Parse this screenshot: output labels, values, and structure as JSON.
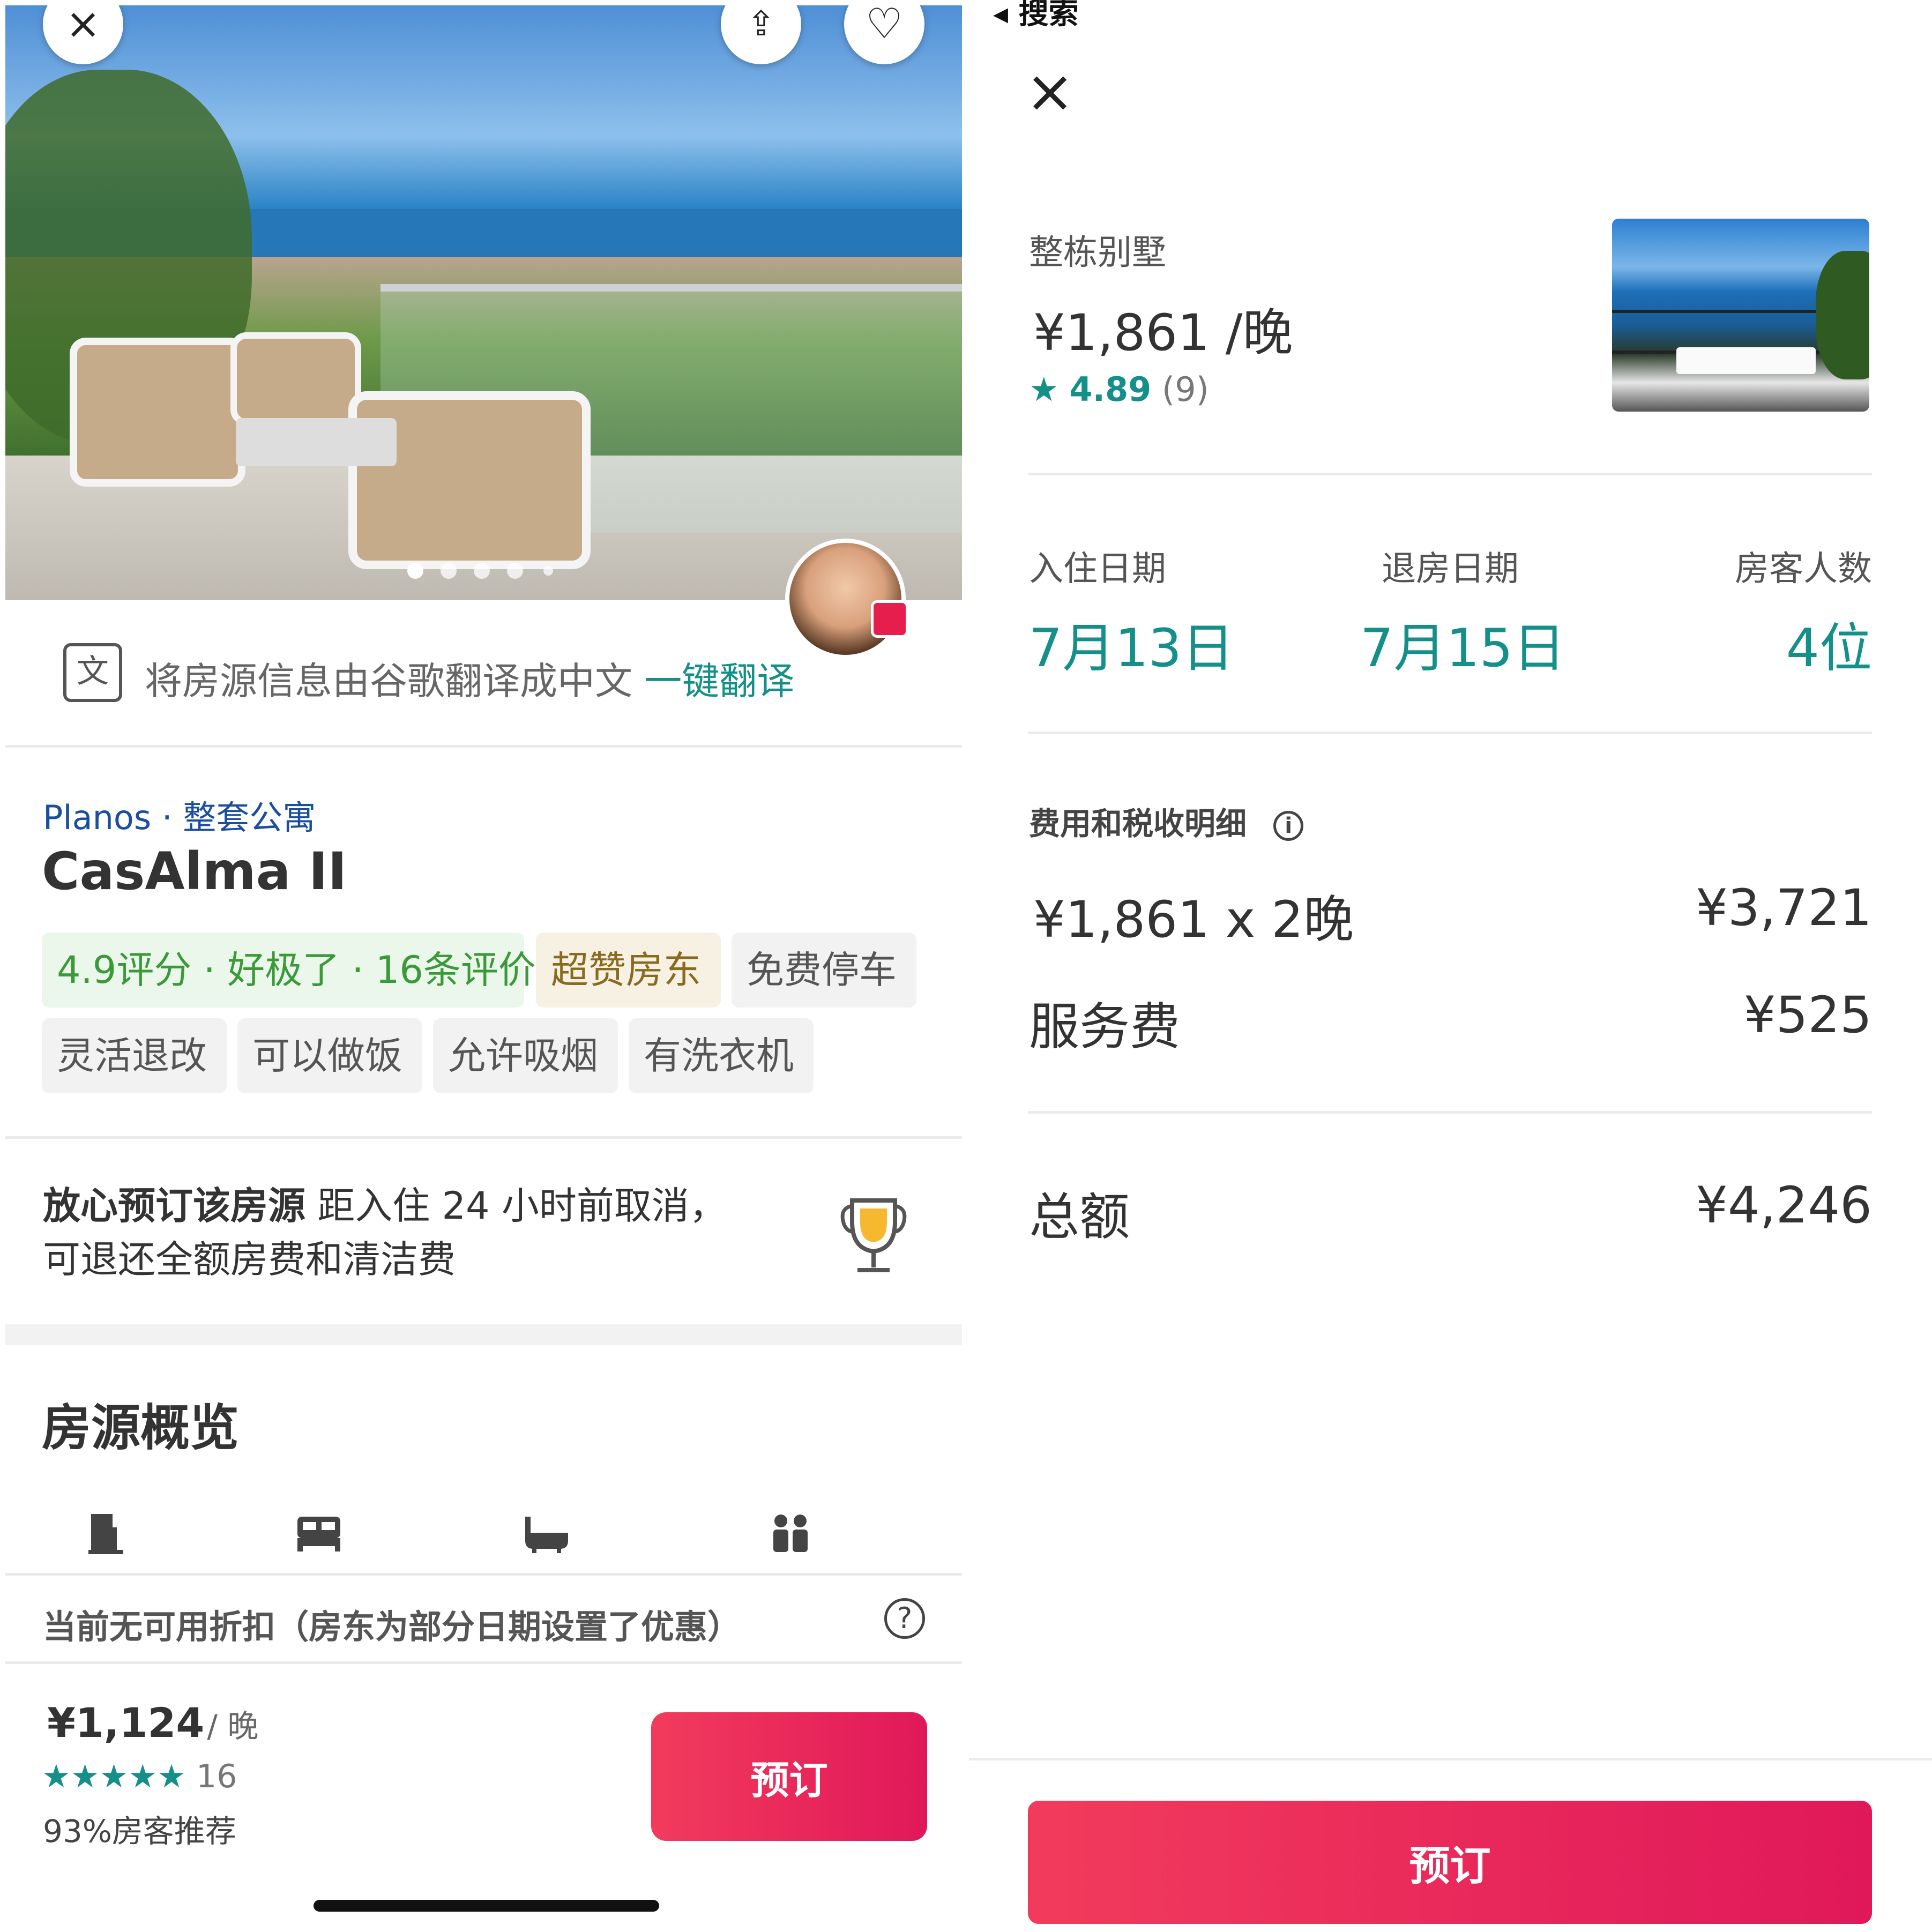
{
  "left": {
    "hero": {
      "close_icon": "×",
      "share_icon": "⇪",
      "favorite_icon": "♡",
      "carousel_count": 5,
      "carousel_active": 1
    },
    "translate": {
      "icon": "translate-icon",
      "text": "将房源信息由谷歌翻译成中文",
      "link": "一键翻译"
    },
    "listing": {
      "location": "Planos",
      "sep": "·",
      "type": "整套公寓",
      "title": "CasAlma II"
    },
    "tags": [
      {
        "label": "4.9评分 · 好极了 · 16条评价",
        "style": "green"
      },
      {
        "label": "超赞房东",
        "style": "gold"
      },
      {
        "label": "免费停车",
        "style": "gray"
      },
      {
        "label": "灵活退改",
        "style": "gray"
      },
      {
        "label": "可以做饭",
        "style": "gray"
      },
      {
        "label": "允许吸烟",
        "style": "gray"
      },
      {
        "label": "有洗衣机",
        "style": "gray"
      }
    ],
    "assurance": {
      "bold": "放心预订该房源",
      "text": " 距入住 24 小时前取消，",
      "line2": "可退还全额房费和清洁费"
    },
    "overview": {
      "title": "房源概览",
      "icons": [
        "door-icon",
        "bed-icon",
        "bath-icon",
        "guests-icon"
      ]
    },
    "discount": {
      "text": "当前无可用折扣（房东为部分日期设置了优惠）",
      "help_icon": "?"
    },
    "footer": {
      "price": "¥1,124",
      "per": "/ 晚",
      "stars": "★★★★★",
      "rating_value": 4.5,
      "review_count": "16",
      "recommend": "93%房客推荐",
      "book_label": "预订"
    },
    "colors": {
      "accent_red": "#e61e4d",
      "teal": "#148f8a",
      "blue": "#1a4fa0"
    }
  },
  "right": {
    "status_back": "◂ 搜索",
    "close_icon": "×",
    "property": {
      "type": "整栋别墅",
      "price": "¥1,861 /晚",
      "star": "★",
      "rating": "4.89",
      "count": "(9)"
    },
    "dates": {
      "checkin_label": "入住日期",
      "checkin_value": "7月13日",
      "checkout_label": "退房日期",
      "checkout_value": "7月15日",
      "guests_label": "房客人数",
      "guests_value": "4位"
    },
    "fees": {
      "title": "费用和税收明细",
      "info_icon": "i",
      "rows": [
        {
          "label": "¥1,861 x 2晚",
          "value": "¥3,721"
        },
        {
          "label": "服务费",
          "value": "¥525"
        }
      ],
      "total_label": "总额",
      "total_value": "¥4,246"
    },
    "book_label": "预订"
  }
}
